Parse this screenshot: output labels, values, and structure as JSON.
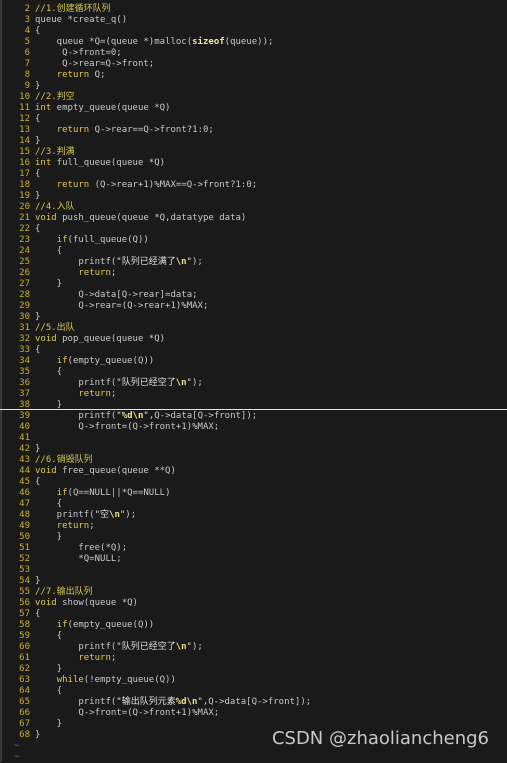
{
  "lines": [
    {
      "n": "2",
      "html": "<span class=\"cm\">//1.创建循环队列</span>"
    },
    {
      "n": "3",
      "html": "queue *create_q()"
    },
    {
      "n": "4",
      "html": "{"
    },
    {
      "n": "5",
      "html": "    queue *Q=(queue *)malloc(<span class=\"sz\">sizeof</span>(queue));"
    },
    {
      "n": "6",
      "html": "     Q-&gt;front=0;"
    },
    {
      "n": "7",
      "html": "     Q-&gt;rear=Q-&gt;front;"
    },
    {
      "n": "8",
      "html": "    <span class=\"kw\">return</span> Q;"
    },
    {
      "n": "9",
      "html": "}"
    },
    {
      "n": "10",
      "html": "<span class=\"cm\">//2.判空</span>"
    },
    {
      "n": "11",
      "html": "<span class=\"kw\">int</span> empty_queue(queue *Q)"
    },
    {
      "n": "12",
      "html": "{"
    },
    {
      "n": "13",
      "html": "    <span class=\"kw\">return</span> Q-&gt;rear==Q-&gt;front?1:0;"
    },
    {
      "n": "14",
      "html": "}"
    },
    {
      "n": "15",
      "html": "<span class=\"cm\">//3.判满</span>"
    },
    {
      "n": "16",
      "html": "<span class=\"kw\">int</span> full_queue(queue *Q)"
    },
    {
      "n": "17",
      "html": "{"
    },
    {
      "n": "18",
      "html": "    <span class=\"kw\">return</span> (Q-&gt;rear+1)%MAX==Q-&gt;front?1:0;"
    },
    {
      "n": "19",
      "html": "}"
    },
    {
      "n": "20",
      "html": "<span class=\"cm\">//4.入队</span>"
    },
    {
      "n": "21",
      "html": "<span class=\"kw\">void</span> push_queue(queue *Q,datatype data)"
    },
    {
      "n": "22",
      "html": "{"
    },
    {
      "n": "23",
      "html": "    <span class=\"kw\">if</span>(full_queue(Q))"
    },
    {
      "n": "24",
      "html": "    {"
    },
    {
      "n": "25",
      "html": "        printf(<span class=\"st\">\"队列已经满了<span class=\"esc\">\\n</span>\"</span>);"
    },
    {
      "n": "26",
      "html": "        <span class=\"kw\">return</span>;"
    },
    {
      "n": "27",
      "html": "    }"
    },
    {
      "n": "28",
      "html": "        Q-&gt;data[Q-&gt;rear]=data;"
    },
    {
      "n": "29",
      "html": "        Q-&gt;rear=(Q-&gt;rear+1)%MAX;"
    },
    {
      "n": "30",
      "html": "}"
    },
    {
      "n": "31",
      "html": "<span class=\"cm\">//5.出队</span>"
    },
    {
      "n": "32",
      "html": "<span class=\"kw\">void</span> pop_queue(queue *Q)"
    },
    {
      "n": "33",
      "html": "{"
    },
    {
      "n": "34",
      "html": "    <span class=\"kw\">if</span>(empty_queue(Q))"
    },
    {
      "n": "35",
      "html": "    {"
    },
    {
      "n": "36",
      "html": "        printf(<span class=\"st\">\"队列已经空了<span class=\"esc\">\\n</span>\"</span>);"
    },
    {
      "n": "37",
      "html": "        <span class=\"kw\">return</span>;"
    },
    {
      "n": "38",
      "html": "    }"
    },
    {
      "n": "39",
      "html": "        printf(<span class=\"st\">\"<span class=\"esc\">%d\\n</span>\"</span>,Q-&gt;data[Q-&gt;front]);"
    },
    {
      "n": "40",
      "html": "        Q-&gt;front=(Q-&gt;front+1)%MAX;"
    },
    {
      "n": "41",
      "html": ""
    },
    {
      "n": "42",
      "html": "}"
    },
    {
      "n": "43",
      "html": "<span class=\"cm\">//6.销毁队列</span>"
    },
    {
      "n": "44",
      "html": "<span class=\"kw\">void</span> free_queue(queue **Q)"
    },
    {
      "n": "45",
      "html": "{"
    },
    {
      "n": "46",
      "html": "    <span class=\"kw\">if</span>(Q==NULL||*Q==NULL)"
    },
    {
      "n": "47",
      "html": "    {"
    },
    {
      "n": "48",
      "html": "    printf(<span class=\"st\">\"空<span class=\"esc\">\\n</span>\"</span>);"
    },
    {
      "n": "49",
      "html": "    <span class=\"kw\">return</span>;"
    },
    {
      "n": "50",
      "html": "    }"
    },
    {
      "n": "51",
      "html": "        free(*Q);"
    },
    {
      "n": "52",
      "html": "        *Q=NULL;"
    },
    {
      "n": "53",
      "html": ""
    },
    {
      "n": "54",
      "html": "}"
    },
    {
      "n": "55",
      "html": "<span class=\"cm\">//7.输出队列</span>"
    },
    {
      "n": "56",
      "html": "<span class=\"kw\">void</span> show(queue *Q)"
    },
    {
      "n": "57",
      "html": "{"
    },
    {
      "n": "58",
      "html": "    <span class=\"kw\">if</span>(empty_queue(Q))"
    },
    {
      "n": "59",
      "html": "    {"
    },
    {
      "n": "60",
      "html": "        printf(<span class=\"st\">\"队列已经空了<span class=\"esc\">\\n</span>\"</span>);"
    },
    {
      "n": "61",
      "html": "        <span class=\"kw\">return</span>;"
    },
    {
      "n": "62",
      "html": "    }"
    },
    {
      "n": "63",
      "html": "    <span class=\"kw\">while</span>(!empty_queue(Q))"
    },
    {
      "n": "64",
      "html": "    {"
    },
    {
      "n": "65",
      "html": "        printf(<span class=\"st\">\"输出队列元素<span class=\"esc\">%d\\n</span>\"</span>,Q-&gt;data[Q-&gt;front]);"
    },
    {
      "n": "66",
      "html": "        Q-&gt;front=(Q-&gt;front+1)%MAX;"
    },
    {
      "n": "67",
      "html": "    }"
    },
    {
      "n": "68",
      "html": "}"
    }
  ],
  "tildes": [
    "~",
    "~"
  ],
  "watermark": "CSDN @zhaoliancheng6"
}
